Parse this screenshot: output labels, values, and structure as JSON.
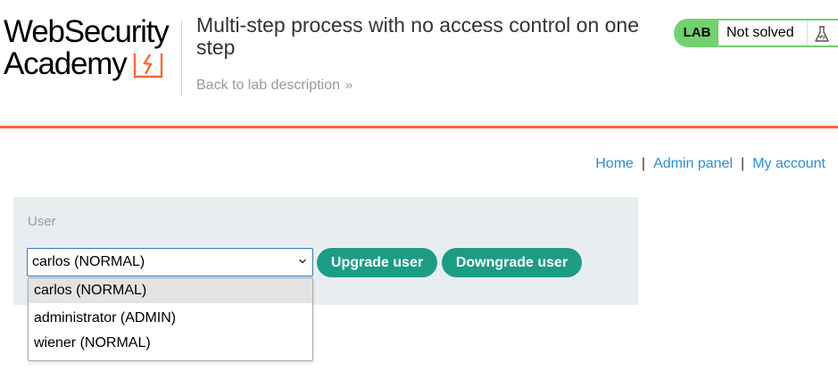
{
  "header": {
    "logo_line1": "WebSecurity",
    "logo_line2": "Academy",
    "lab_title": "Multi-step process with no access control on one step",
    "back_link": "Back to lab description",
    "lab_badge": "LAB",
    "lab_status": "Not solved",
    "icons": {
      "back_chevron": "double-chevron-right-icon",
      "lab_flask": "flask-icon",
      "logo_mark": "academy-logo-mark-icon"
    },
    "colors": {
      "accent_orange": "#ff6633",
      "lab_green": "#70d16d",
      "link_blue": "#2a8fd8"
    }
  },
  "nav": {
    "items": [
      {
        "label": "Home"
      },
      {
        "label": "Admin panel"
      },
      {
        "label": "My account"
      }
    ],
    "separator": "|"
  },
  "form": {
    "user_label": "User",
    "selected_user": "carlos (NORMAL)",
    "upgrade_label": "Upgrade user",
    "downgrade_label": "Downgrade user",
    "button_color": "#1c9c85",
    "options": [
      {
        "label": "carlos (NORMAL)",
        "highlighted": true
      },
      {
        "label": "administrator (ADMIN)",
        "highlighted": false
      },
      {
        "label": "wiener (NORMAL)",
        "highlighted": false
      }
    ]
  }
}
